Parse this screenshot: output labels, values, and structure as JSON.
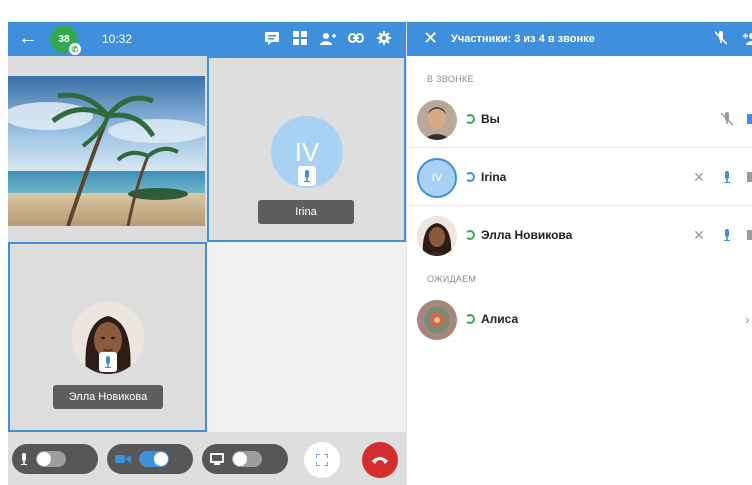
{
  "topbar": {
    "unread_count": "38",
    "time": "10:32",
    "icons": [
      "back-arrow-icon",
      "chat-icon",
      "grid-layout-icon",
      "participants-icon",
      "link-icon",
      "settings-icon"
    ]
  },
  "tiles": {
    "irina": {
      "initials": "IV",
      "name": "Irina"
    },
    "ella": {
      "name": "Элла Новикова"
    }
  },
  "controls": {
    "mic_toggle": "off",
    "camera_toggle": "on",
    "screen_toggle": "off"
  },
  "panel": {
    "title": "Участники: 3 из 4 в звонке",
    "section_in_call": "В ЗВОНКЕ",
    "section_waiting": "ОЖИДАЕМ",
    "participants": [
      {
        "name": "Вы"
      },
      {
        "name": "Irina",
        "initials": "IV"
      },
      {
        "name": "Элла Новикова"
      }
    ],
    "waiting": [
      {
        "name": "Алиса"
      }
    ]
  },
  "colors": {
    "accent": "#3f8fdd",
    "status_green": "#35a853",
    "hangup_red": "#d32f2f"
  }
}
